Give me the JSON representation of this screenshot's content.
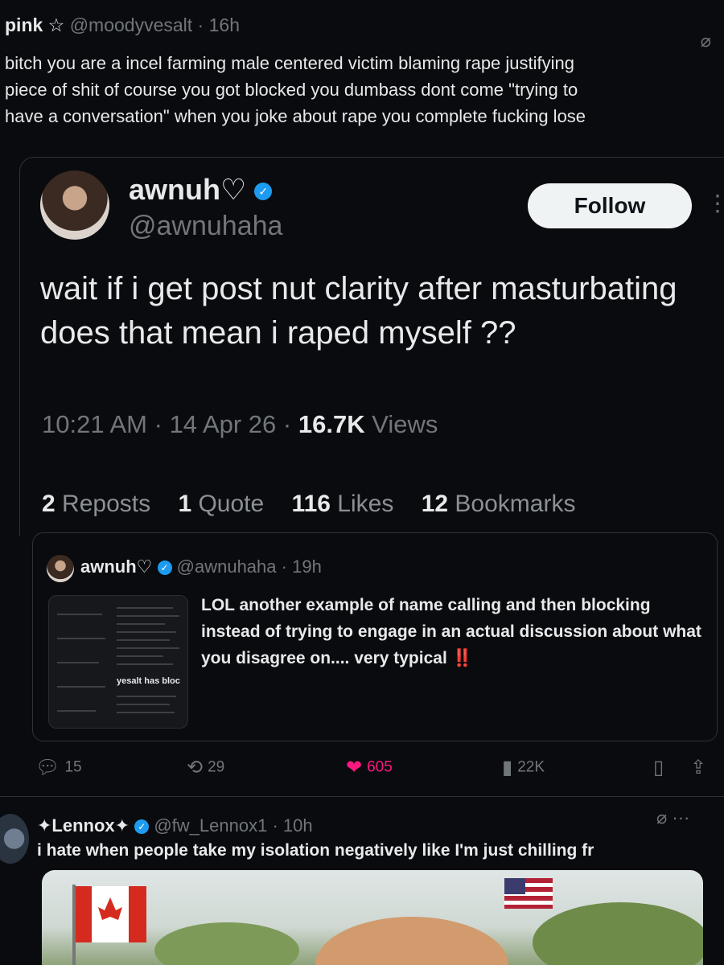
{
  "top_tweet": {
    "name": "pink",
    "name_glyph": "☆",
    "handle": "@moodyvesalt",
    "time": "16h",
    "text_lines": [
      "bitch you are a incel farming male centered victim blaming rape justifying",
      "piece of shit of course you got blocked you dumbass dont come \"trying to",
      "have a conversation\" when you joke about rape you complete fucking lose"
    ],
    "grok_icon": "slash-circle-icon"
  },
  "quoted_card": {
    "name": "awnuh♡",
    "handle": "@awnuhaha",
    "follow_label": "Follow",
    "more_icon": "⋮",
    "text": "wait if i get post nut clarity after masturbating does that mean i raped myself ??",
    "time": "10:21 AM",
    "date": "14 Apr 26",
    "views_count": "16.7K",
    "views_label": "Views",
    "stats": [
      {
        "value": "2",
        "label": "Reposts"
      },
      {
        "value": "1",
        "label": "Quote"
      },
      {
        "value": "116",
        "label": "Likes"
      },
      {
        "value": "12",
        "label": "Bookmarks"
      }
    ],
    "inner_quote": {
      "name": "awnuh♡",
      "handle": "@awnuhaha",
      "time": "19h",
      "thumbnail_text": "yesalt has bloc",
      "text": "LOL another example of name calling and then blocking instead of trying to engage in an actual discussion about what you disagree on.... very typical ‼️"
    }
  },
  "actions": {
    "replies": "15",
    "reposts": "29",
    "likes": "605",
    "views": "22K"
  },
  "next_tweet": {
    "name": "✦Lennox✦",
    "handle": "@fw_Lennox1",
    "time": "10h",
    "text": "i hate when people take my isolation negatively like I'm just chilling fr"
  },
  "colors": {
    "background": "#0a0b0e",
    "verified": "#1d9bf0",
    "like": "#f91880",
    "muted": "#71767b"
  }
}
